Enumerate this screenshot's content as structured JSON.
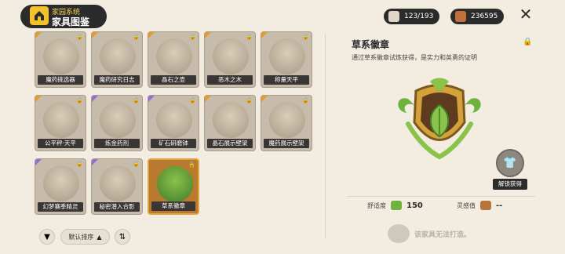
{
  "header": {
    "small_title": "家园系统",
    "big_title": "家具图鉴",
    "collection_count": "123/193",
    "currency": "236595",
    "close_label": "✕"
  },
  "cards": [
    {
      "label": "魔药挑选器",
      "rarity": "orange",
      "locked": true
    },
    {
      "label": "魔药研究日志",
      "rarity": "orange",
      "locked": true
    },
    {
      "label": "晶石之壶",
      "rarity": "orange",
      "locked": true
    },
    {
      "label": "恶木之木",
      "rarity": "orange",
      "locked": true
    },
    {
      "label": "称量天平",
      "rarity": "orange",
      "locked": true
    },
    {
      "label": "公平秤·天平",
      "rarity": "orange",
      "locked": true
    },
    {
      "label": "炼金药剂",
      "rarity": "purple",
      "locked": true
    },
    {
      "label": "矿石研磨钵",
      "rarity": "purple",
      "locked": true
    },
    {
      "label": "晶石展示壁架",
      "rarity": "orange",
      "locked": true
    },
    {
      "label": "魔药展示壁架",
      "rarity": "orange",
      "locked": true
    },
    {
      "label": "幻梦赛季精灵",
      "rarity": "purple",
      "locked": true
    },
    {
      "label": "秘密潜入合影",
      "rarity": "purple",
      "locked": true
    },
    {
      "label": "草系徽章",
      "rarity": "orange",
      "locked": true,
      "selected": true
    }
  ],
  "controls": {
    "filter_icon": "funnel-icon",
    "sort_label": "默认排序",
    "sort_arrow": "▲",
    "order_icon": "sort-order-icon"
  },
  "detail": {
    "title": "草系徽章",
    "description": "通过草系徽章试炼获得，是实力和英勇的证明",
    "unlock_label": "解锁获得",
    "comfort_label": "舒适度",
    "comfort_value": "150",
    "inspiration_label": "灵感值",
    "inspiration_value": "--",
    "no_craft_text": "该家具无法打造。"
  },
  "colors": {
    "background": "#f3ece1",
    "rarity_orange": "#e89b2a",
    "rarity_purple": "#9a6ad8",
    "badge_green": "#6fb23e",
    "badge_gold": "#d4a13a"
  }
}
